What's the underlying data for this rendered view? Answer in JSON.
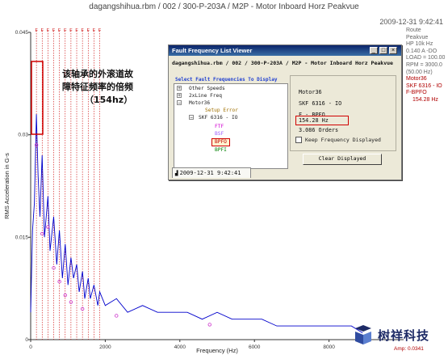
{
  "header": {
    "title": "dagangshihua.rbm / 002 / 300-P-203A / M2P - Motor Inboard Horz Peakvue",
    "date": "2009-12-31 9:42:41"
  },
  "info_panel": {
    "lines": [
      "Route",
      "Peakvue",
      "HP 10k Hz",
      "0.140 A -DO",
      "LOAD = 100.00",
      "RPM = 3000.0",
      "(50.00 Hz)"
    ],
    "red_lines": [
      "Motor36",
      "SKF 6316 - IO",
      "F-BPFO",
      "154.28 Hz"
    ]
  },
  "annotation": {
    "line1": "该轴承的外滚道故",
    "line2": "障特征频率的倍频",
    "line3": "（154hz）"
  },
  "dialog": {
    "title": "Fault Frequency List Viewer",
    "path": "dagangshihua.rbm / 002 / 300-P-203A / M2P - Motor Inboard Horz Peakvue",
    "select_label": "Select Fault Frequencies To Display",
    "tree": {
      "other_speeds": "Other Speeds",
      "line_freq": "2xLine Freq",
      "motor36": "Motor36",
      "setup_error": "Setup Error",
      "skf": "SKF 6316 - IO",
      "ftf": "FTF",
      "bsf": "BSF",
      "bpfo": "BPFO",
      "bpfi": "BPFI"
    },
    "details": {
      "name": "Motor36",
      "bearing": "SKF 6316 - IO",
      "fault": "F - BPFO",
      "frequency": "154.28 Hz",
      "orders": "3.086 Orders"
    },
    "keep_label": "Keep Frequency Displayed",
    "clear_button": "Clear Displayed",
    "tab_label": "2009-12-31  9:42:41",
    "buttons": {
      "minimize": "_",
      "maximize": "□",
      "close": "×"
    }
  },
  "logo": {
    "text": "树祥科技"
  },
  "amp_label": "Amp: 0.0341",
  "colors": {
    "spectrum": "#0000cc",
    "fault_lines": "#cc0000",
    "highlight": "#d00000",
    "marker": "#cc33cc"
  },
  "chart_data": {
    "type": "line",
    "title": "",
    "xlabel": "Frequency (Hz)",
    "ylabel": "RMS Acceleration in G-s",
    "xlim": [
      0,
      10000
    ],
    "ylim": [
      0,
      0.045
    ],
    "x_ticks": [
      0,
      2000,
      4000,
      6000,
      8000
    ],
    "y_ticks": [
      0,
      0.015,
      0.03,
      0.045
    ],
    "y_tick_labels": [
      "0",
      "0.015",
      "0.03",
      "0.045"
    ],
    "fault_frequency_hz": 154.28,
    "fault_harmonics_hz": [
      154.28,
      308.56,
      462.84,
      617.12,
      771.4,
      925.68,
      1079.96,
      1234.24,
      1388.52,
      1542.8,
      1697.08,
      1851.36
    ],
    "series": [
      {
        "name": "",
        "x": [
          0,
          50,
          100,
          154,
          200,
          250,
          308,
          370,
          463,
          520,
          617,
          700,
          771,
          850,
          926,
          1000,
          1080,
          1150,
          1234,
          1300,
          1389,
          1450,
          1543,
          1600,
          1697,
          1800,
          1851,
          2000,
          2300,
          2600,
          3000,
          3400,
          3800,
          4200,
          4600,
          5000,
          5400,
          5800,
          6200,
          6600,
          7000,
          7400,
          7800,
          8200,
          8600,
          8900
        ],
        "y": [
          0.004,
          0.016,
          0.02,
          0.033,
          0.024,
          0.018,
          0.027,
          0.015,
          0.021,
          0.013,
          0.018,
          0.011,
          0.016,
          0.009,
          0.014,
          0.008,
          0.012,
          0.009,
          0.011,
          0.007,
          0.01,
          0.006,
          0.009,
          0.006,
          0.008,
          0.005,
          0.007,
          0.005,
          0.006,
          0.004,
          0.005,
          0.004,
          0.004,
          0.004,
          0.003,
          0.004,
          0.003,
          0.003,
          0.003,
          0.002,
          0.002,
          0.002,
          0.002,
          0.002,
          0.002,
          0.001
        ]
      }
    ],
    "markers": [
      {
        "x": 154,
        "y": 0.0285
      },
      {
        "x": 308,
        "y": 0.0155
      },
      {
        "x": 463,
        "y": 0.0165
      },
      {
        "x": 617,
        "y": 0.0105
      },
      {
        "x": 771,
        "y": 0.0085
      },
      {
        "x": 926,
        "y": 0.0065
      },
      {
        "x": 1080,
        "y": 0.0055
      },
      {
        "x": 1389,
        "y": 0.0045
      },
      {
        "x": 2300,
        "y": 0.0035
      },
      {
        "x": 4800,
        "y": 0.0022
      }
    ],
    "grid": false,
    "legend": "none"
  }
}
